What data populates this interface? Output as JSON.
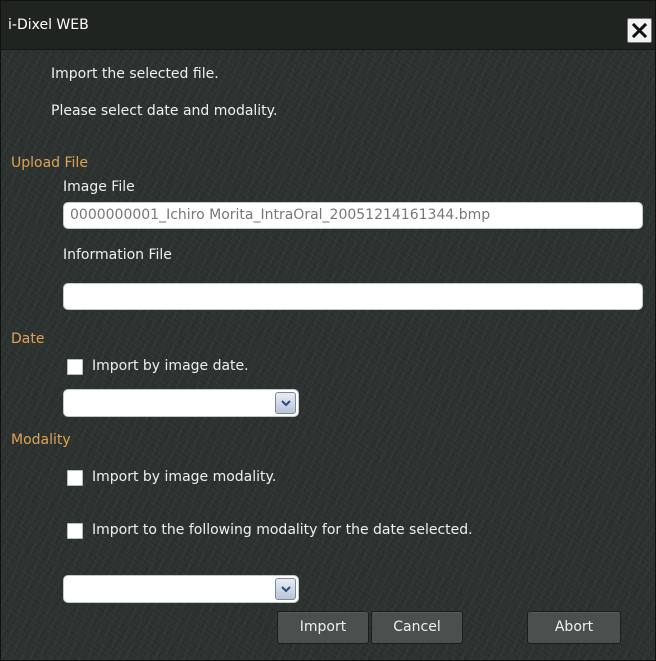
{
  "window": {
    "title": "i-Dixel WEB"
  },
  "intro": {
    "line1": "Import the selected file.",
    "line2": "Please select date and modality."
  },
  "upload": {
    "section_label": "Upload File",
    "image_file_label": "Image File",
    "image_file_value": "0000000001_Ichiro Morita_IntraOral_20051214161344.bmp",
    "info_file_label": "Information File",
    "info_file_value": ""
  },
  "date": {
    "section_label": "Date",
    "checkbox_label": "Import by image date.",
    "checked": false,
    "selected_value": ""
  },
  "modality": {
    "section_label": "Modality",
    "checkbox1_label": "Import by image modality.",
    "checkbox2_label": "Import to the following modality for the date selected.",
    "checked1": false,
    "checked2": false,
    "selected_value": ""
  },
  "buttons": {
    "import": "Import",
    "cancel": "Cancel",
    "abort": "Abort"
  },
  "colors": {
    "section": "#e2a257",
    "background": "#2c322f"
  },
  "icons": {
    "close": "close-icon",
    "dropdown": "chevron-down-icon"
  }
}
